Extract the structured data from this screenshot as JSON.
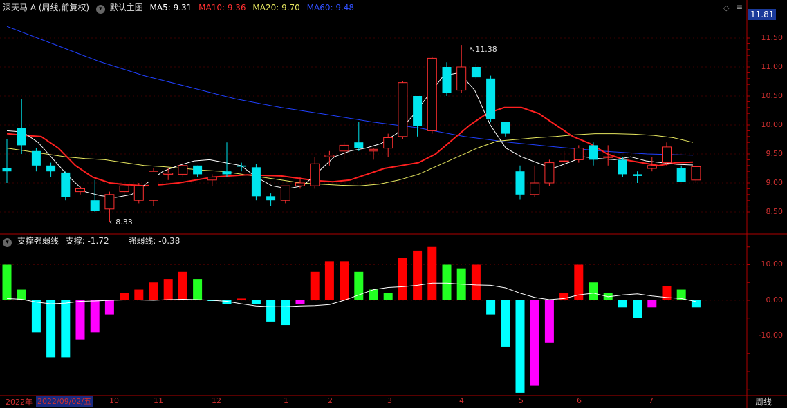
{
  "main_header": {
    "title": "深天马 A (周线,前复权)",
    "template": "默认主图",
    "ma5": "MA5: 9.31",
    "ma10": "MA10: 9.36",
    "ma20": "MA20: 9.70",
    "ma60": "MA60: 9.48"
  },
  "price_tag": "11.81",
  "price_axis": [
    "11.50",
    "11.00",
    "10.50",
    "10.00",
    "9.50",
    "9.00",
    "8.50"
  ],
  "annot_high": "11.38",
  "annot_low": "8.33",
  "sub_header": {
    "title": "支撑强弱线",
    "support": "支撑: -1.72",
    "strength": "强弱线: -0.38"
  },
  "sub_axis": [
    "10.00",
    "0.00",
    "-10.00"
  ],
  "time_axis": {
    "year": "2022年",
    "selected_date": "2022/09/02/五",
    "months": [
      "10",
      "11",
      "12",
      "1",
      "2",
      "3",
      "4",
      "5",
      "6",
      "7"
    ],
    "period": "周线"
  },
  "colors": {
    "up": "#ff3030",
    "down": "#00e5ee",
    "ma5": "#ffffff",
    "ma10": "#ff2020",
    "ma20": "#e8e860",
    "ma60": "#2040ff",
    "bar_red": "#ff0000",
    "bar_green": "#22ff22",
    "bar_cyan": "#00ffff",
    "bar_magenta": "#ff00ff",
    "axis_red": "#b00000"
  },
  "chart_data": [
    {
      "type": "candlestick",
      "title": "深天马 A (周线,前复权)",
      "ylim": [
        8.2,
        11.85
      ],
      "series": [
        {
          "name": "MA5",
          "values": [
            9.9,
            9.88,
            9.7,
            9.4,
            9.1,
            8.85,
            8.78,
            8.75,
            8.8,
            9.0,
            9.2,
            9.3,
            9.38,
            9.4,
            9.35,
            9.3,
            9.1,
            8.95,
            8.9,
            8.95,
            9.2,
            9.45,
            9.55,
            9.6,
            9.68,
            9.85,
            10.15,
            10.5,
            10.85,
            10.9,
            10.6,
            10.0,
            9.6,
            9.45,
            9.35,
            9.25,
            9.35,
            9.45,
            9.42,
            9.4,
            9.45,
            9.38,
            9.35,
            9.32,
            9.31
          ]
        },
        {
          "name": "MA10",
          "values": [
            9.85,
            9.82,
            9.8,
            9.6,
            9.3,
            9.1,
            9.0,
            8.97,
            8.95,
            8.97,
            9.0,
            9.05,
            9.1,
            9.12,
            9.14,
            9.13,
            9.12,
            9.08,
            9.04,
            9.02,
            9.05,
            9.15,
            9.25,
            9.3,
            9.35,
            9.5,
            9.75,
            10.0,
            10.2,
            10.3,
            10.3,
            10.2,
            10.0,
            9.8,
            9.68,
            9.5,
            9.4,
            9.35,
            9.3,
            9.35,
            9.36
          ]
        },
        {
          "name": "MA20",
          "values": [
            9.6,
            9.55,
            9.5,
            9.45,
            9.42,
            9.4,
            9.35,
            9.3,
            9.28,
            9.25,
            9.22,
            9.2,
            9.15,
            9.1,
            9.05,
            9.0,
            8.98,
            8.96,
            8.95,
            8.98,
            9.05,
            9.15,
            9.3,
            9.45,
            9.6,
            9.72,
            9.75,
            9.78,
            9.8,
            9.83,
            9.85,
            9.85,
            9.84,
            9.82,
            9.78,
            9.7
          ]
        },
        {
          "name": "MA60",
          "values": [
            11.7,
            11.4,
            11.1,
            10.85,
            10.65,
            10.45,
            10.3,
            10.18,
            10.05,
            9.95,
            9.8,
            9.7,
            9.62,
            9.55,
            9.5,
            9.48
          ]
        }
      ],
      "annotations": [
        {
          "label": "11.38",
          "value": 11.38
        },
        {
          "label": "8.33",
          "value": 8.33
        }
      ]
    },
    {
      "type": "bar",
      "title": "支撑强弱线",
      "ylim": [
        -26,
        14
      ],
      "values": [
        10,
        3,
        -9,
        -16,
        -16,
        -11,
        -9,
        -4,
        2,
        3,
        5,
        6,
        8,
        6,
        0,
        -1,
        0.5,
        -1,
        -6,
        -7,
        -1,
        8,
        11,
        11,
        8,
        3,
        2,
        12,
        14,
        15,
        10,
        9,
        10,
        -4,
        -13,
        -26,
        -24,
        -12,
        2,
        10,
        5,
        2,
        -2,
        -5,
        -2,
        4,
        3,
        -2
      ],
      "series": [
        {
          "name": "强弱线",
          "values": [
            0.5,
            0.3,
            -0.5,
            -1,
            -0.8,
            -0.3,
            -0.2,
            0,
            0.1,
            0.1,
            0,
            0.2,
            0.3,
            0.2,
            0,
            -0.3,
            -1,
            -1.6,
            -1.8,
            -1.8,
            -1.6,
            -1.5,
            -1.2,
            0,
            1.5,
            3,
            3.6,
            3.8,
            4.2,
            4.8,
            4.8,
            4.5,
            4.3,
            4.2,
            3.5,
            2.0,
            0.8,
            0.2,
            0.5,
            1.5,
            2.0,
            1.0,
            1.5,
            1.8,
            1.2,
            0.8,
            0.5,
            -0.38
          ]
        }
      ]
    }
  ]
}
